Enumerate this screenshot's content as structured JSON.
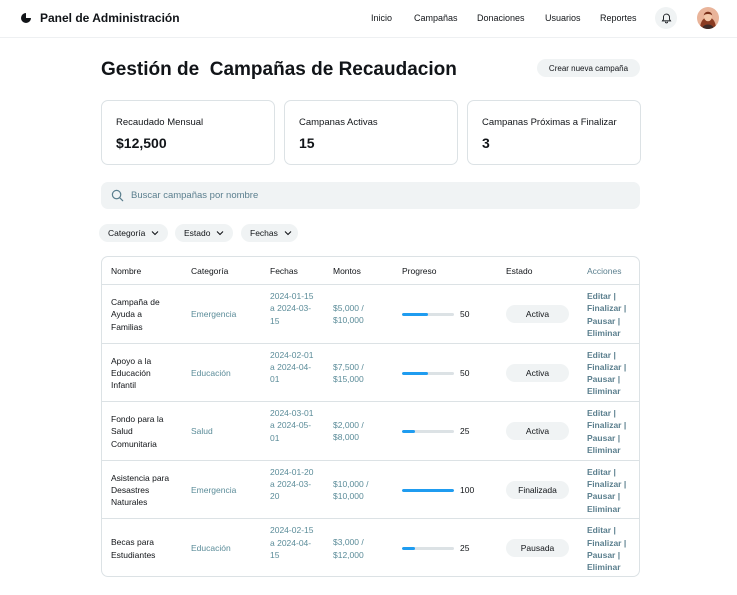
{
  "header": {
    "brand": "Panel de Administración",
    "nav": [
      "Inicio",
      "Campañas",
      "Donaciones",
      "Usuarios",
      "Reportes"
    ],
    "icons": {
      "notifications": "bell-icon",
      "profile": "avatar"
    }
  },
  "page": {
    "title": "Gestión de  Campañas de Recaudacion",
    "create_button": "Crear nueva campaña"
  },
  "stats": [
    {
      "label": "Recaudado Mensual",
      "value": "$12,500"
    },
    {
      "label": "Campanas Activas",
      "value": "15"
    },
    {
      "label": "Campanas Próximas a Finalizar",
      "value": "3"
    }
  ],
  "search": {
    "placeholder": "Buscar campañas por nombre"
  },
  "filters": [
    "Categoría",
    "Estado",
    "Fechas"
  ],
  "table": {
    "headers": [
      "Nombre",
      "Categoría",
      "Fechas",
      "Montos",
      "Progreso",
      "Estado",
      "Acciones"
    ],
    "rows": [
      {
        "name": "Campaña de Ayuda a Familias",
        "category": "Emergencia",
        "dates": "2024-01-15 a 2024-03-15",
        "amounts": "$5,000 / $10,000",
        "progress": 50,
        "progress_label": "50",
        "status": "Activa"
      },
      {
        "name": "Apoyo a la Educación Infantil",
        "category": "Educación",
        "dates": "2024-02-01 a 2024-04-01",
        "amounts": "$7,500 / $15,000",
        "progress": 50,
        "progress_label": "50",
        "status": "Activa"
      },
      {
        "name": "Fondo para la Salud Comunitaria",
        "category": "Salud",
        "dates": "2024-03-01 a 2024-05-01",
        "amounts": "$2,000 / $8,000",
        "progress": 25,
        "progress_label": "25",
        "status": "Activa"
      },
      {
        "name": "Asistencia para Desastres Naturales",
        "category": "Emergencia",
        "dates": "2024-01-20 a 2024-03-20",
        "amounts": "$10,000 / $10,000",
        "progress": 100,
        "progress_label": "100",
        "status": "Finalizada"
      },
      {
        "name": "Becas para Estudiantes",
        "category": "Educación",
        "dates": "2024-02-15 a 2024-04-15",
        "amounts": "$3,000 / $12,000",
        "progress": 25,
        "progress_label": "25",
        "status": "Pausada"
      }
    ],
    "actions": [
      "Editar |",
      "Finalizar |",
      "Pausar |",
      "Eliminar"
    ]
  },
  "colors": {
    "accent": "#1f9cf0",
    "muted_text": "#5b7f8e",
    "chip_bg": "#f0f3f4",
    "border": "#dce2e5"
  }
}
